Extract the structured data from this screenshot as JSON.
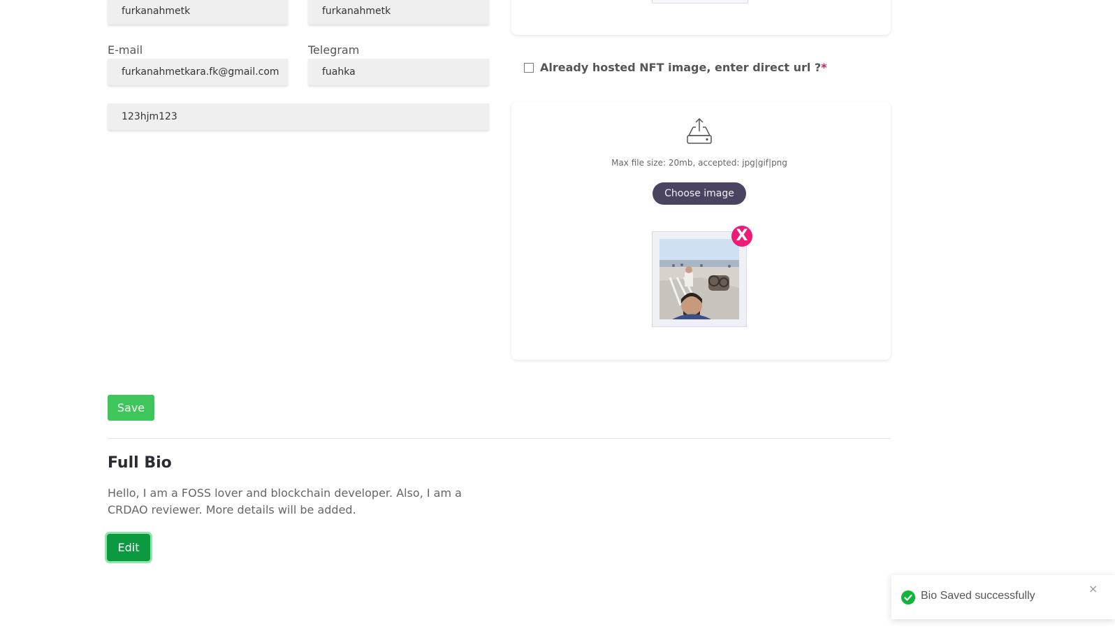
{
  "form": {
    "field_top_left_value": "furkanahmetk",
    "field_top_right_value": "furkanahmetk",
    "email_label": "E-mail",
    "email_value": "furkanahmetkara.fk@gmail.com",
    "telegram_label": "Telegram",
    "telegram_value": "fuahka",
    "wallet_value": "123hjm123",
    "save_label": "Save"
  },
  "nft": {
    "checkbox_label": "Already hosted NFT image, enter direct url ?",
    "checkbox_required_mark": "*",
    "checkbox_checked": false,
    "upload_hint": "Max file size: 20mb, accepted: jpg|gif|png",
    "choose_label": "Choose image",
    "remove_label": "X",
    "upload_icon": "upload-tray-icon"
  },
  "bio": {
    "title": "Full Bio",
    "text": "Hello, I am a FOSS lover and blockchain developer. Also, I am a CRDAO reviewer. More details will be added.",
    "edit_label": "Edit"
  },
  "toast": {
    "message": "Bio Saved successfully",
    "close_symbol": "×",
    "status_icon": "check-circle-icon"
  },
  "colors": {
    "save_green": "#3ec65a",
    "edit_green": "#0b9a3f",
    "choose_purple": "#4a4460",
    "remove_pink": "#ee1a78",
    "success_green": "#12b53b"
  }
}
